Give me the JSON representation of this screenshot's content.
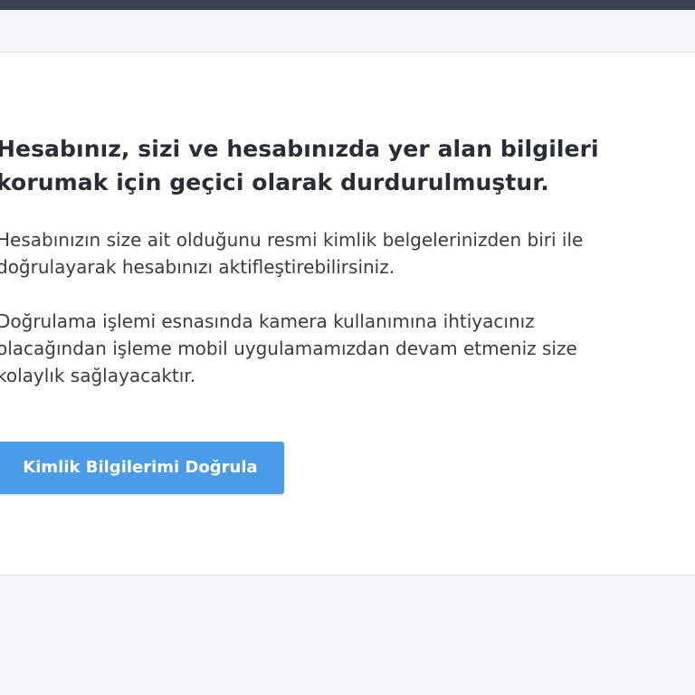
{
  "message": {
    "heading_line1": "Hesabınız, sizi ve hesabınızda yer alan bilgileri",
    "heading_line2": "korumak için geçici olarak durdurulmuştur.",
    "para1_line1": "Hesabınızın size ait olduğunu resmi kimlik belgelerinizden biri ile",
    "para1_line2": "doğrulayarak hesabınızı aktifleştirebilirsiniz.",
    "para2_line1": "Doğrulama işlemi esnasında kamera kullanımına ihtiyacınız",
    "para2_line2": "olacağından işleme mobil uygulamamızdan devam etmeniz size",
    "para2_line3": "kolaylık sağlayacaktır."
  },
  "actions": {
    "verify_label": "Kimlik Bilgilerimi Doğrula"
  },
  "colors": {
    "topbar": "#3d4256",
    "button": "#4a9be8",
    "heading_text": "#2b2d36",
    "body_text": "#3a3c45"
  }
}
